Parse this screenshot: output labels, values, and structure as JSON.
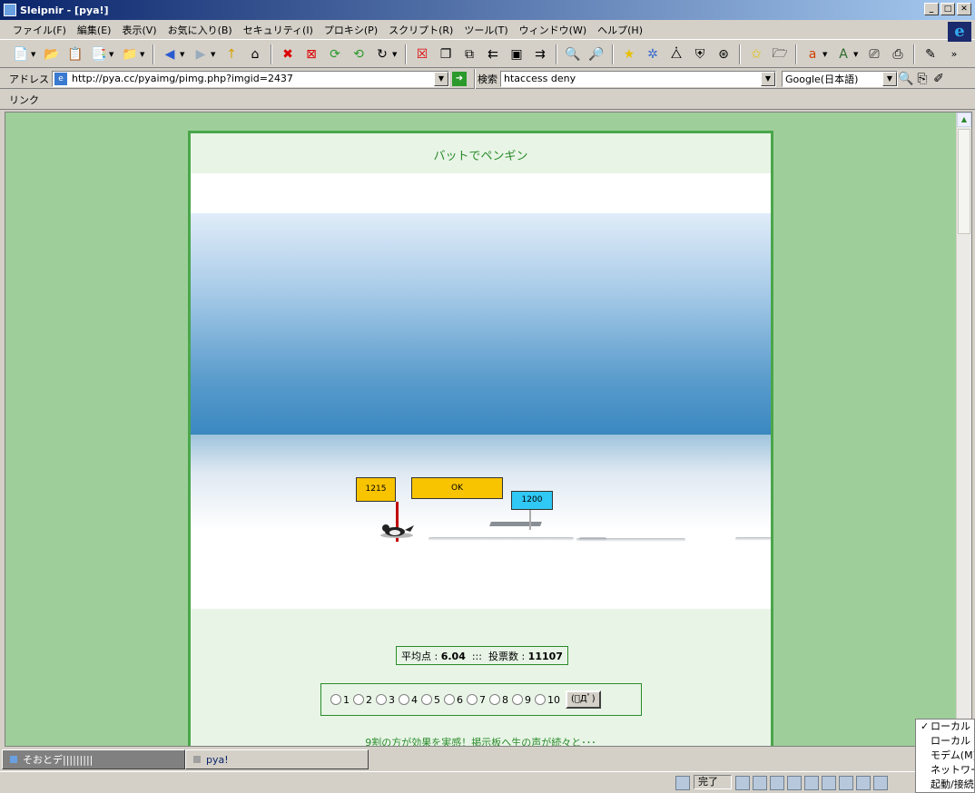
{
  "window": {
    "title": "Sleipnir - [pya!]"
  },
  "menu": [
    "ファイル(F)",
    "編集(E)",
    "表示(V)",
    "お気に入り(B)",
    "セキュリティ(I)",
    "プロキシ(P)",
    "スクリプト(R)",
    "ツール(T)",
    "ウィンドウ(W)",
    "ヘルプ(H)"
  ],
  "address": {
    "label": "アドレス",
    "url": "http://pya.cc/pyaimg/pimg.php?imgid=2437",
    "search_label": "検索",
    "search_value": "htaccess deny",
    "engine": "Google(日本語)"
  },
  "links": {
    "label": "リンク"
  },
  "page": {
    "title": "バットでペンギン",
    "game": {
      "sign_distance": "1215",
      "sign_result": "OK",
      "sign_record": "1200"
    },
    "score": {
      "avg_label": "平均点 :",
      "avg_value": "6.04",
      "separator": ":::",
      "votes_label": "投票数 :",
      "votes_value": "11107"
    },
    "vote_options": [
      "1",
      "2",
      "3",
      "4",
      "5",
      "6",
      "7",
      "8",
      "9",
      "10"
    ],
    "vote_button": "(ﾟДﾟ)",
    "promo": "9割の方が効果を実感！掲示板へ生の声が続々と･･･"
  },
  "tabs": [
    {
      "label": "そおとデ|||||||||"
    },
    {
      "label": "pya!"
    }
  ],
  "status": {
    "text": "完了"
  },
  "popup": {
    "items": [
      "ローカル U",
      "ローカル シ",
      "モデム(M)",
      "ネットワーク",
      "起動/接続"
    ]
  },
  "colors": {
    "page_bg": "#9ecf9a",
    "panel_border": "#4aa64a",
    "title_green": "#2a8a2a",
    "sign_yellow": "#f8c400",
    "sign_blue": "#30c8f4"
  }
}
